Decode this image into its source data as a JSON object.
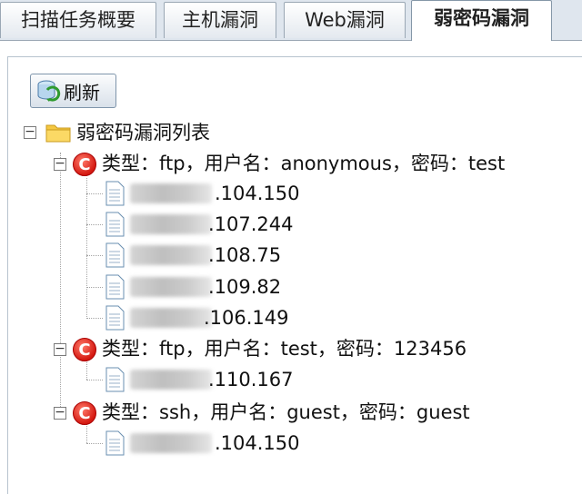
{
  "tabs": [
    {
      "label": "扫描任务概要"
    },
    {
      "label": "主机漏洞"
    },
    {
      "label": "Web漏洞"
    },
    {
      "label": "弱密码漏洞"
    }
  ],
  "active_tab": "弱密码漏洞",
  "toolbar": {
    "refresh_label": "刷新"
  },
  "tree": {
    "root_label": "弱密码漏洞列表",
    "groups": [
      {
        "label": "类型：ftp，用户名：anonymous，密码：test",
        "hosts": [
          ".104.150",
          ".107.244",
          ".108.75",
          ".109.82",
          ".106.149"
        ]
      },
      {
        "label": "类型：ftp，用户名：test，密码：123456",
        "hosts": [
          ".110.167"
        ]
      },
      {
        "label": "类型：ssh，用户名：guest，密码：guest",
        "hosts": [
          ".104.150"
        ]
      }
    ]
  },
  "colors": {
    "tab_bar": "#dfe6ee",
    "c_icon": "#d51a12",
    "folder": "#f5c842"
  },
  "icons": {
    "refresh": "refresh-icon",
    "folder": "folder-icon",
    "vuln": "c-vuln-icon",
    "document": "document-icon"
  }
}
